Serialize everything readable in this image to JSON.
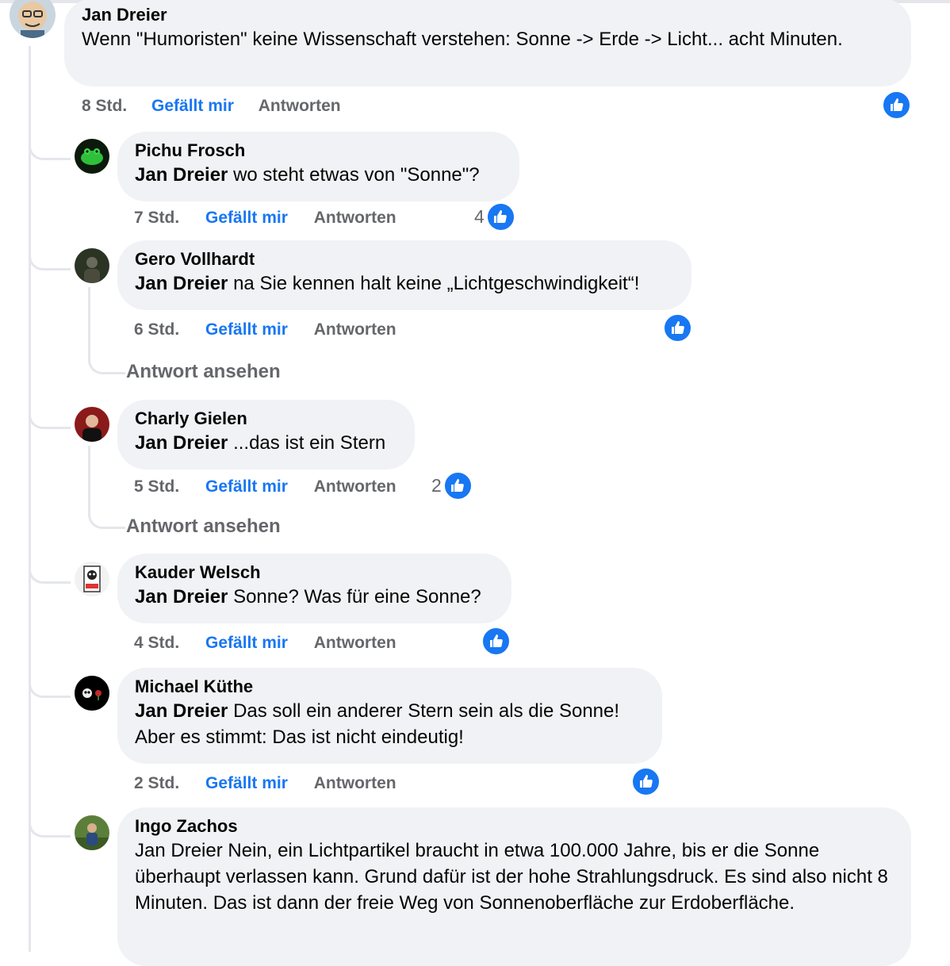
{
  "comments": [
    {
      "author": "Jan Dreier",
      "text": "Wenn \"Humoristen\" keine Wissenschaft verstehen: Sonne -> Erde -> Licht... acht Minuten.",
      "time": "8 Std.",
      "like_label": "Gefällt mir",
      "reply_label": "Antworten",
      "reaction_count": "",
      "reaction_icon": "like-icon",
      "avatar_icon": "cartoon-man-with-glasses"
    }
  ],
  "replies": [
    {
      "author": "Pichu Frosch",
      "mention": "Jan Dreier",
      "text": " wo steht etwas von \"Sonne\"?",
      "time": "7 Std.",
      "like_label": "Gefällt mir",
      "reply_label": "Antworten",
      "reaction_count": "4",
      "avatar_icon": "green-frog"
    },
    {
      "author": "Gero Vollhardt",
      "mention": "Jan Dreier",
      "text": " na Sie kennen halt keine „Lichtgeschwindigkeit“!",
      "time": "6 Std.",
      "like_label": "Gefällt mir",
      "reply_label": "Antworten",
      "reaction_count": "",
      "view_replies": "Antwort ansehen",
      "avatar_icon": "dark-forest-person"
    },
    {
      "author": "Charly Gielen",
      "mention": "Jan Dreier",
      "text": " ...das ist ein Stern",
      "time": "5 Std.",
      "like_label": "Gefällt mir",
      "reply_label": "Antworten",
      "reaction_count": "2",
      "view_replies": "Antwort ansehen",
      "avatar_icon": "man-portrait-red-background"
    },
    {
      "author": "Kauder Welsch",
      "mention": "Jan Dreier",
      "text": " Sonne? Was für eine Sonne?",
      "time": "4 Std.",
      "like_label": "Gefällt mir",
      "reply_label": "Antworten",
      "reaction_count": "",
      "avatar_icon": "skull-poster"
    },
    {
      "author": "Michael Küthe",
      "mention": "Jan Dreier",
      "text": " Das soll ein anderer Stern sein als die Sonne! Aber es stimmt: Das ist nicht eindeutig!",
      "time": "2 Std.",
      "like_label": "Gefällt mir",
      "reply_label": "Antworten",
      "reaction_count": "",
      "avatar_icon": "black-skull-logo"
    },
    {
      "author": "Ingo Zachos",
      "mention": "",
      "text": "Jan Dreier Nein, ein Lichtpartikel braucht in etwa 100.000 Jahre, bis er die Sonne überhaupt verlassen kann. Grund dafür ist der hohe Strahlungsdruck. Es sind also nicht 8 Minuten. Das ist dann der freie Weg von Sonnenoberfläche zur Erdoberfläche.",
      "avatar_icon": "person-outdoors"
    }
  ],
  "colors": {
    "like_blue": "#1877f2",
    "bubble_bg": "#f0f2f5",
    "meta_gray": "#65676b",
    "thread_line": "#e4e6eb"
  }
}
